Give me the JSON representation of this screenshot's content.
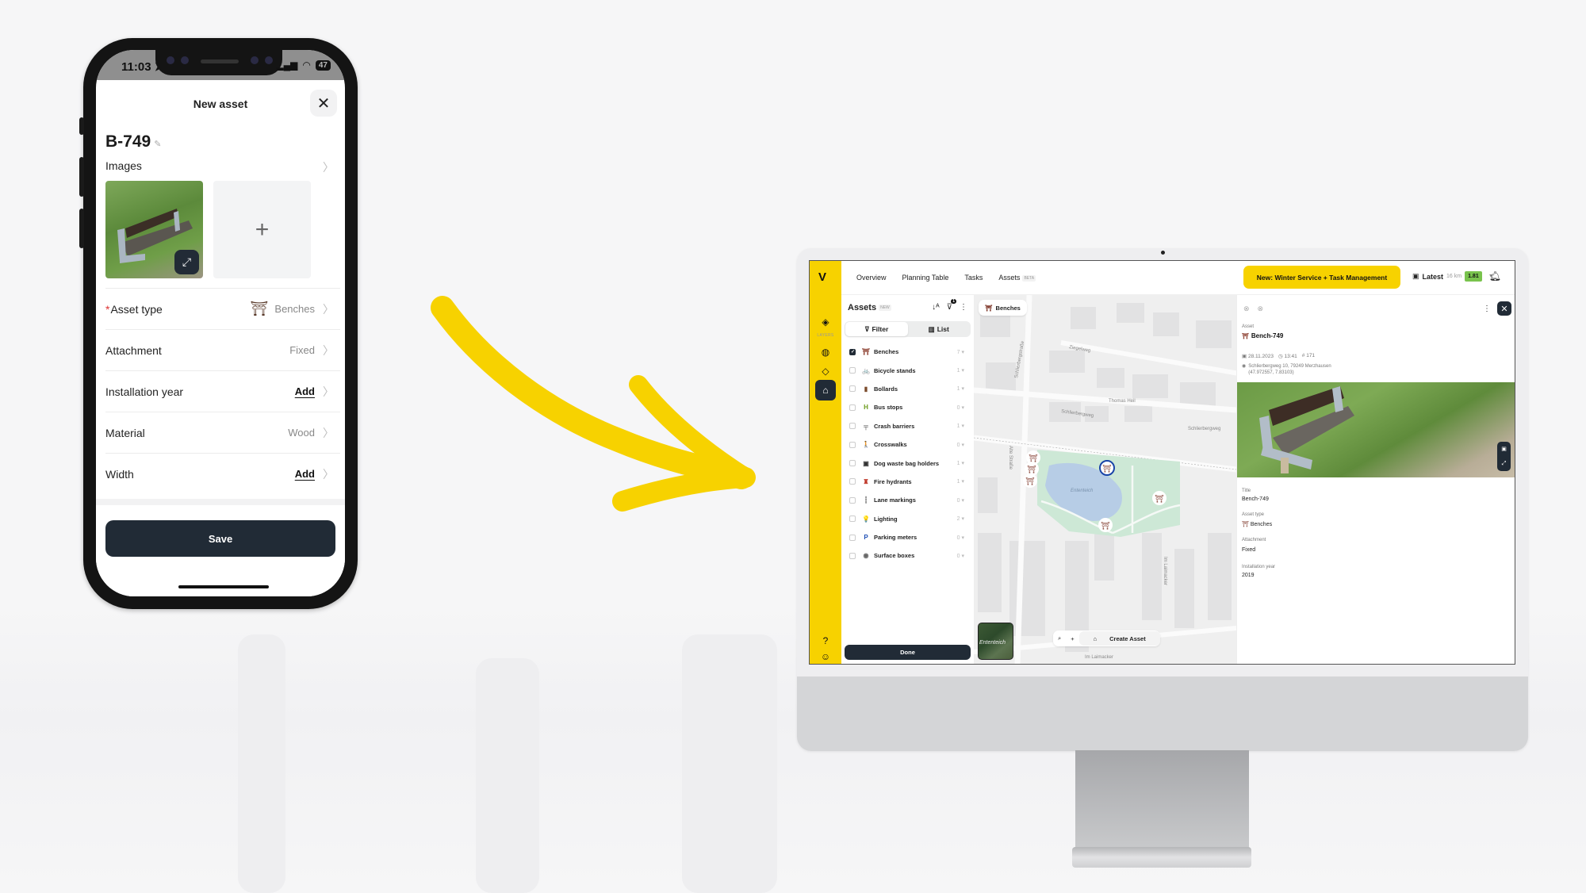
{
  "phone": {
    "status_time": "11:03",
    "battery": "47",
    "sheet_title": "New asset",
    "asset_id": "B-749",
    "images_label": "Images",
    "add_image_glyph": "+",
    "fields": [
      {
        "label": "Asset type",
        "required": true,
        "value": "Benches",
        "value_icon": "bench-icon",
        "kind": "value"
      },
      {
        "label": "Attachment",
        "required": false,
        "value": "Fixed",
        "kind": "value"
      },
      {
        "label": "Installation year",
        "required": false,
        "value": "Add",
        "kind": "add"
      },
      {
        "label": "Material",
        "required": false,
        "value": "Wood",
        "kind": "value"
      },
      {
        "label": "Width",
        "required": false,
        "value": "Add",
        "kind": "add"
      }
    ],
    "save_label": "Save"
  },
  "desktop": {
    "nav": [
      {
        "label": "Overview"
      },
      {
        "label": "Planning Table"
      },
      {
        "label": "Tasks"
      },
      {
        "label": "Assets",
        "badge": "BETA"
      }
    ],
    "promo_label": "New: Winter Service + Task Management",
    "latest_label": "Latest",
    "latest_km": "16 km",
    "latest_score": "1.81",
    "rail_layers_label": "LAYERS",
    "assets_panel": {
      "title": "Assets",
      "title_badge": "NEW",
      "filter_count": "1",
      "tab_filter": "Filter",
      "tab_list": "List",
      "active_tab": "Filter",
      "layers": [
        {
          "name": "Benches",
          "count": "7",
          "checked": true,
          "icon": "bench-icon",
          "glyph": "⛩",
          "color": "#8a3b2b"
        },
        {
          "name": "Bicycle stands",
          "count": "1",
          "checked": false,
          "icon": "bicycle-icon",
          "glyph": "🚲",
          "color": "#2a4fa8"
        },
        {
          "name": "Bollards",
          "count": "1",
          "checked": false,
          "icon": "bollard-icon",
          "glyph": "▮",
          "color": "#7a4a2a"
        },
        {
          "name": "Bus stops",
          "count": "0",
          "checked": false,
          "icon": "bus-stop-icon",
          "glyph": "H",
          "color": "#6a9a1a"
        },
        {
          "name": "Crash barriers",
          "count": "1",
          "checked": false,
          "icon": "crash-barrier-icon",
          "glyph": "╤",
          "color": "#444"
        },
        {
          "name": "Crosswalks",
          "count": "0",
          "checked": false,
          "icon": "crosswalk-icon",
          "glyph": "🚶",
          "color": "#333"
        },
        {
          "name": "Dog waste bag holders",
          "count": "1",
          "checked": false,
          "icon": "dog-waste-icon",
          "glyph": "▣",
          "color": "#333"
        },
        {
          "name": "Fire hydrants",
          "count": "1",
          "checked": false,
          "icon": "hydrant-icon",
          "glyph": "♜",
          "color": "#c0392b"
        },
        {
          "name": "Lane markings",
          "count": "0",
          "checked": false,
          "icon": "lane-marking-icon",
          "glyph": "┆",
          "color": "#333"
        },
        {
          "name": "Lighting",
          "count": "2",
          "checked": false,
          "icon": "lightbulb-icon",
          "glyph": "💡",
          "color": "#d4b000"
        },
        {
          "name": "Parking meters",
          "count": "0",
          "checked": false,
          "icon": "parking-meter-icon",
          "glyph": "P",
          "color": "#1f4fb5"
        },
        {
          "name": "Surface boxes",
          "count": "0",
          "checked": false,
          "icon": "surface-box-icon",
          "glyph": "◉",
          "color": "#666"
        }
      ],
      "done_label": "Done"
    },
    "map": {
      "chip_label": "Benches",
      "create_label": "Create Asset",
      "satellite_label": "Ententeich",
      "street_labels": [
        "Ziegelweg",
        "Schlierbergweg",
        "Schlierbergweg",
        "Schlierbergstraße",
        "Alte Straße",
        "Im Laimacker",
        "Im Laimacker",
        "Thomas Heil",
        "Ententeich"
      ]
    },
    "detail": {
      "section_label": "Asset",
      "asset_name": "Bench-749",
      "date": "28.11.2023",
      "time": "13:41",
      "number": "# 171",
      "address": "Schlierbergweg 10, 79249 Merzhausen",
      "coords": "(47.972557, 7.83103)",
      "fields": [
        {
          "label": "Title",
          "value": "Bench-749"
        },
        {
          "label": "Asset type",
          "value": "Benches"
        },
        {
          "label": "Attachment",
          "value": "Fixed"
        },
        {
          "label": "Installation year",
          "value": "2019"
        }
      ]
    }
  }
}
